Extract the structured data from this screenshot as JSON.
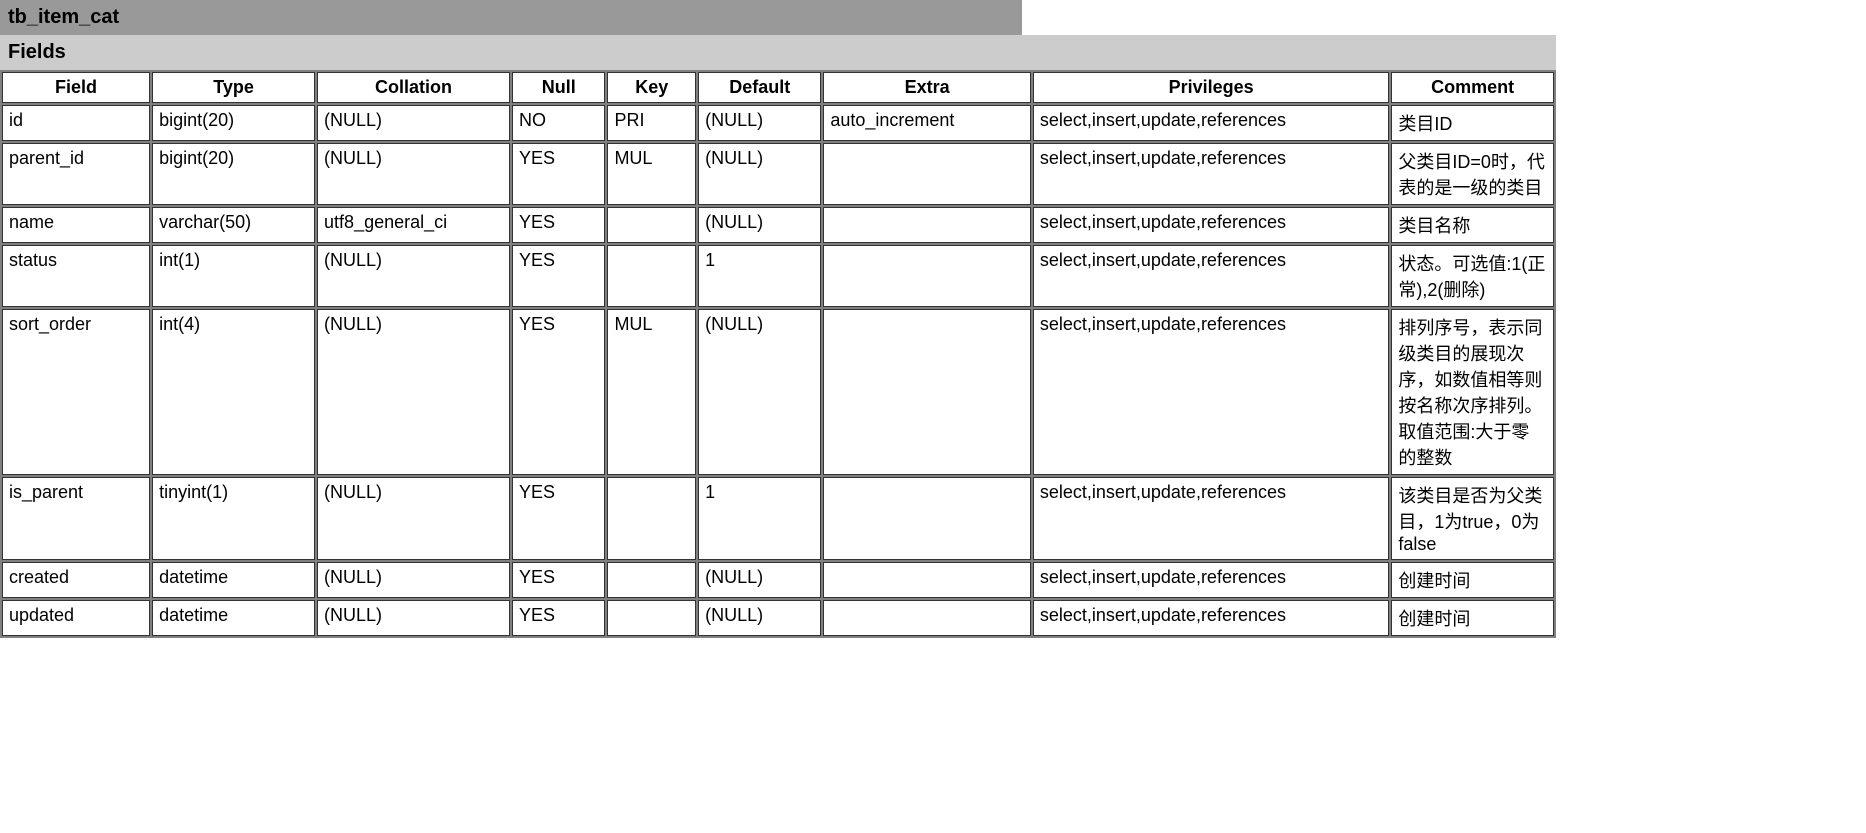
{
  "title": "tb_item_cat",
  "section": "Fields",
  "headers": {
    "field": "Field",
    "type": "Type",
    "collation": "Collation",
    "null": "Null",
    "key": "Key",
    "default": "Default",
    "extra": "Extra",
    "privileges": "Privileges",
    "comment": "Comment"
  },
  "rows": [
    {
      "field": "id",
      "type": "bigint(20)",
      "collation": "(NULL)",
      "null": "NO",
      "key": "PRI",
      "default": "(NULL)",
      "extra": "auto_increment",
      "privileges": "select,insert,update,references",
      "comment": "类目ID"
    },
    {
      "field": "parent_id",
      "type": "bigint(20)",
      "collation": "(NULL)",
      "null": "YES",
      "key": "MUL",
      "default": "(NULL)",
      "extra": "",
      "privileges": "select,insert,update,references",
      "comment": "父类目ID=0时，代表的是一级的类目"
    },
    {
      "field": "name",
      "type": "varchar(50)",
      "collation": "utf8_general_ci",
      "null": "YES",
      "key": "",
      "default": "(NULL)",
      "extra": "",
      "privileges": "select,insert,update,references",
      "comment": "类目名称"
    },
    {
      "field": "status",
      "type": "int(1)",
      "collation": "(NULL)",
      "null": "YES",
      "key": "",
      "default": "1",
      "extra": "",
      "privileges": "select,insert,update,references",
      "comment": "状态。可选值:1(正常),2(删除)"
    },
    {
      "field": "sort_order",
      "type": "int(4)",
      "collation": "(NULL)",
      "null": "YES",
      "key": "MUL",
      "default": "(NULL)",
      "extra": "",
      "privileges": "select,insert,update,references",
      "comment": "排列序号，表示同级类目的展现次序，如数值相等则按名称次序排列。取值范围:大于零的整数"
    },
    {
      "field": "is_parent",
      "type": "tinyint(1)",
      "collation": "(NULL)",
      "null": "YES",
      "key": "",
      "default": "1",
      "extra": "",
      "privileges": "select,insert,update,references",
      "comment": "该类目是否为父类目，1为true，0为false"
    },
    {
      "field": "created",
      "type": "datetime",
      "collation": "(NULL)",
      "null": "YES",
      "key": "",
      "default": "(NULL)",
      "extra": "",
      "privileges": "select,insert,update,references",
      "comment": "创建时间"
    },
    {
      "field": "updated",
      "type": "datetime",
      "collation": "(NULL)",
      "null": "YES",
      "key": "",
      "default": "(NULL)",
      "extra": "",
      "privileges": "select,insert,update,references",
      "comment": "创建时间"
    }
  ]
}
